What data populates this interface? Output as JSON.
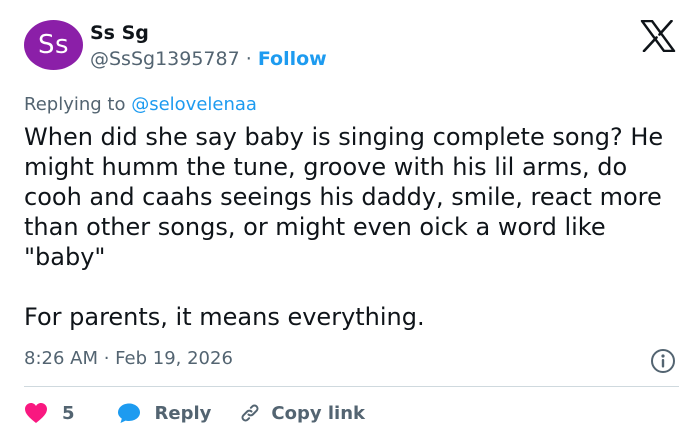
{
  "author": {
    "avatar_initials": "Ss",
    "avatar_color": "#8b1fa8",
    "name": "Ss Sg",
    "handle": "@SsSg1395787",
    "separator": "·",
    "follow_label": "Follow"
  },
  "reply_context": {
    "prefix": "Replying to",
    "mention": "@selovelenaa"
  },
  "tweet": {
    "text": "When did she say baby is singing complete song? He might humm the tune, groove with his lil arms, do cooh and caahs seeings his daddy, smile, react more than other songs, or might even oick a word like \"baby\"\n\nFor parents, it means everything.",
    "timestamp": "8:26 AM · Feb 19, 2026"
  },
  "actions": {
    "like_count": "5",
    "reply_label": "Reply",
    "copy_link_label": "Copy link"
  },
  "icons": {
    "platform": "x-logo-icon",
    "info": "info-icon",
    "like": "heart-icon",
    "reply": "speech-bubble-icon",
    "copy": "link-icon"
  },
  "colors": {
    "accent": "#1d9bf0",
    "like": "#f91880",
    "muted": "#536471",
    "text": "#0f1419"
  }
}
